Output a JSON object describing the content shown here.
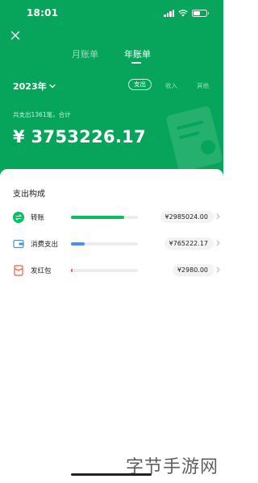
{
  "status": {
    "time": "18:01"
  },
  "tabs": {
    "month": "月账单",
    "year": "年账单"
  },
  "filters": {
    "year": "2023年",
    "expense": "支出",
    "income": "收入",
    "other": "其他"
  },
  "summary": {
    "label": "共支出1361笔，合计",
    "total": "¥ 3753226.17"
  },
  "breakdown": {
    "title": "支出构成",
    "items": [
      {
        "label": "转账",
        "amount": "¥2985024.00",
        "ratio": 0.8,
        "color": "#07c160",
        "icon": "transfer-icon"
      },
      {
        "label": "消费支出",
        "amount": "¥765222.17",
        "ratio": 0.2,
        "color": "#4a90e2",
        "icon": "wallet-icon"
      },
      {
        "label": "发红包",
        "amount": "¥2980.00",
        "ratio": 0.01,
        "color": "#f25c4a",
        "icon": "red-packet-icon"
      }
    ]
  },
  "watermark": "字节手游网"
}
